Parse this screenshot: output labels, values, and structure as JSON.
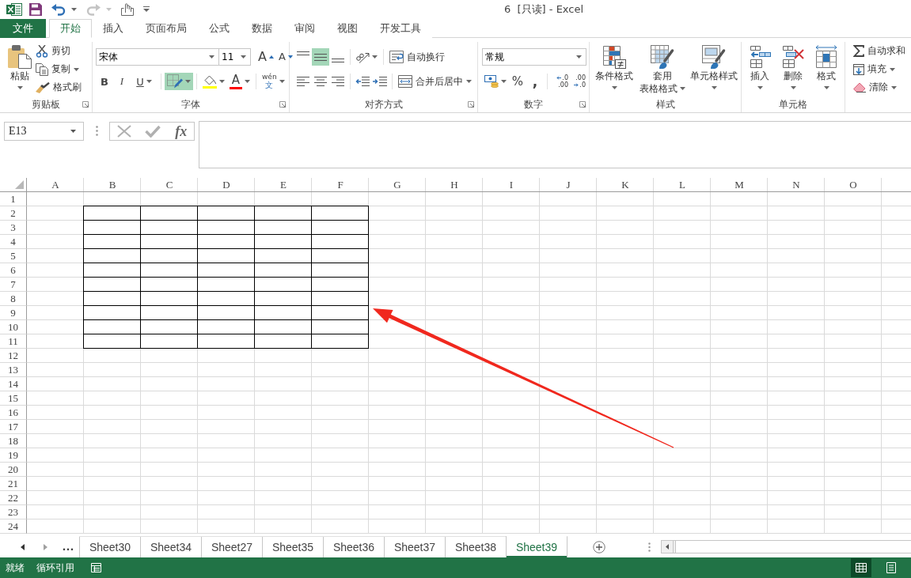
{
  "window": {
    "title": "6  [只读] - Excel"
  },
  "quick_access": [
    {
      "kind": "save",
      "disabled": false
    },
    {
      "kind": "undo",
      "disabled": false
    },
    {
      "kind": "redo",
      "disabled": true
    },
    {
      "kind": "touch",
      "disabled": false
    },
    {
      "kind": "customize",
      "disabled": false
    }
  ],
  "ribbon_tabs": [
    {
      "label": "文件",
      "kind": "file",
      "selected": false
    },
    {
      "label": "开始",
      "kind": "tab",
      "selected": true
    },
    {
      "label": "插入",
      "kind": "tab",
      "selected": false
    },
    {
      "label": "页面布局",
      "kind": "tab",
      "selected": false
    },
    {
      "label": "公式",
      "kind": "tab",
      "selected": false
    },
    {
      "label": "数据",
      "kind": "tab",
      "selected": false
    },
    {
      "label": "审阅",
      "kind": "tab",
      "selected": false
    },
    {
      "label": "视图",
      "kind": "tab",
      "selected": false
    },
    {
      "label": "开发工具",
      "kind": "tab",
      "selected": false
    }
  ],
  "clipboard": {
    "label": "剪贴板",
    "paste": "粘贴",
    "cut": "剪切",
    "copy": "复制",
    "format_painter": "格式刷"
  },
  "font": {
    "label": "字体",
    "font_name": "宋体",
    "font_size": "11",
    "grow": "A",
    "shrink": "A",
    "styles": [
      "B",
      "I",
      "U"
    ],
    "borders_selected": true,
    "font_color_letter": "A",
    "phonetic_top": "wén",
    "phonetic_bottom": "文"
  },
  "alignment": {
    "label": "对齐方式",
    "vertical": [
      {
        "kind": "top",
        "selected": false
      },
      {
        "kind": "middle",
        "selected": true
      },
      {
        "kind": "bottom",
        "selected": false
      }
    ],
    "horizontal": [
      {
        "kind": "left",
        "selected": false
      },
      {
        "kind": "center",
        "selected": false
      },
      {
        "kind": "right",
        "selected": false
      }
    ],
    "wrap_text": "自动换行",
    "merge_center": "合并后居中"
  },
  "number": {
    "label": "数字",
    "format": "常规",
    "percent": "%",
    "comma": ",",
    "decimals": [
      {
        "kind": "increase",
        "top": ".0",
        "bottom": ".00"
      },
      {
        "kind": "decrease",
        "top": ".00",
        "bottom": ".0"
      }
    ]
  },
  "styles": {
    "label": "样式",
    "buttons": [
      {
        "kind": "conditional",
        "lines": [
          "条件格式"
        ]
      },
      {
        "kind": "table",
        "lines": [
          "套用",
          "表格格式"
        ]
      },
      {
        "kind": "cell",
        "lines": [
          "单元格样式"
        ]
      }
    ]
  },
  "cells": {
    "label": "单元格",
    "buttons": [
      {
        "kind": "insert",
        "label": "插入"
      },
      {
        "kind": "delete",
        "label": "删除"
      },
      {
        "kind": "format",
        "label": "格式"
      }
    ]
  },
  "editing": {
    "buttons": [
      {
        "kind": "autosum",
        "label": "自动求和"
      },
      {
        "kind": "fill",
        "label": "填充"
      },
      {
        "kind": "clear",
        "label": "清除"
      }
    ]
  },
  "formula_bar": {
    "name_box": "E13",
    "function_label": "fx"
  },
  "sheet": {
    "columns": [
      {
        "label": "A",
        "bordered": false
      },
      {
        "label": "B",
        "bordered": true
      },
      {
        "label": "C",
        "bordered": true
      },
      {
        "label": "D",
        "bordered": true
      },
      {
        "label": "E",
        "bordered": true
      },
      {
        "label": "F",
        "bordered": true
      },
      {
        "label": "G",
        "bordered": false
      },
      {
        "label": "H",
        "bordered": false
      },
      {
        "label": "I",
        "bordered": false
      },
      {
        "label": "J",
        "bordered": false
      },
      {
        "label": "K",
        "bordered": false
      },
      {
        "label": "L",
        "bordered": false
      },
      {
        "label": "M",
        "bordered": false
      },
      {
        "label": "N",
        "bordered": false
      },
      {
        "label": "O",
        "bordered": false
      }
    ],
    "rows": [
      {
        "label": "1",
        "bordered": false
      },
      {
        "label": "2",
        "bordered": true
      },
      {
        "label": "3",
        "bordered": true
      },
      {
        "label": "4",
        "bordered": true
      },
      {
        "label": "5",
        "bordered": true
      },
      {
        "label": "6",
        "bordered": true
      },
      {
        "label": "7",
        "bordered": true
      },
      {
        "label": "8",
        "bordered": true
      },
      {
        "label": "9",
        "bordered": true
      },
      {
        "label": "10",
        "bordered": true
      },
      {
        "label": "11",
        "bordered": true
      },
      {
        "label": "12",
        "bordered": false
      },
      {
        "label": "13",
        "bordered": false
      },
      {
        "label": "14",
        "bordered": false
      },
      {
        "label": "15",
        "bordered": false
      },
      {
        "label": "16",
        "bordered": false
      },
      {
        "label": "17",
        "bordered": false
      },
      {
        "label": "18",
        "bordered": false
      },
      {
        "label": "19",
        "bordered": false
      },
      {
        "label": "20",
        "bordered": false
      },
      {
        "label": "21",
        "bordered": false
      },
      {
        "label": "22",
        "bordered": false
      },
      {
        "label": "23",
        "bordered": false
      },
      {
        "label": "24",
        "bordered": false
      }
    ]
  },
  "annotations": [
    {
      "kind": "arrow"
    }
  ],
  "sheet_tabs": {
    "more": "...",
    "tabs": [
      {
        "label": "Sheet30",
        "selected": false
      },
      {
        "label": "Sheet34",
        "selected": false
      },
      {
        "label": "Sheet27",
        "selected": false
      },
      {
        "label": "Sheet35",
        "selected": false
      },
      {
        "label": "Sheet36",
        "selected": false
      },
      {
        "label": "Sheet37",
        "selected": false
      },
      {
        "label": "Sheet38",
        "selected": false
      },
      {
        "label": "Sheet39",
        "selected": true
      }
    ]
  },
  "status_bar": {
    "items": [
      "就绪",
      "循环引用"
    ],
    "views": [
      {
        "kind": "normal",
        "selected": true
      },
      {
        "kind": "page_layout",
        "selected": false
      }
    ]
  }
}
